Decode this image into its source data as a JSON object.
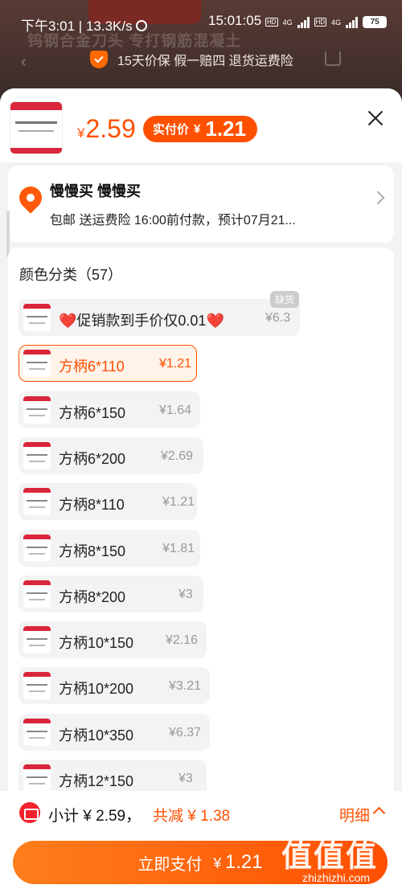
{
  "status_bar": {
    "left_text": "下午3:01 | 13.3K/s",
    "time": "15:01:05",
    "network_badge": "HD",
    "network_type": "4G",
    "battery": "75"
  },
  "background_page": {
    "banner_text": "钨钢合金刀头 专打钢筋混凝土",
    "guarantee_text": "15天价保  假一赔四  退货运费险"
  },
  "product": {
    "currency": "¥",
    "original_price": "2.59",
    "real_price_label": "实付价",
    "real_price": "1.21"
  },
  "address": {
    "name": "慢慢买 慢慢买",
    "info": "包邮  送运费险  16:00前付款，预计07月21..."
  },
  "variants": {
    "title": "颜色分类（57）",
    "out_of_stock_label": "缺货",
    "options": [
      {
        "name": "❤️促销款到手价仅0.01❤️",
        "price": "¥6.3"
      },
      {
        "name": "方柄6*110",
        "price": "¥1.21"
      },
      {
        "name": "方柄6*150",
        "price": "¥1.64"
      },
      {
        "name": "方柄6*200",
        "price": "¥2.69"
      },
      {
        "name": "方柄8*110",
        "price": "¥1.21"
      },
      {
        "name": "方柄8*150",
        "price": "¥1.81"
      },
      {
        "name": "方柄8*200",
        "price": "¥3"
      },
      {
        "name": "方柄10*150",
        "price": "¥2.16"
      },
      {
        "name": "方柄10*200",
        "price": "¥3.21"
      },
      {
        "name": "方柄10*350",
        "price": "¥6.37"
      },
      {
        "name": "方柄12*150",
        "price": "¥3"
      }
    ]
  },
  "bottom": {
    "subtotal": "小计 ¥ 2.59，",
    "discount": "共减 ¥ 1.38",
    "detail_label": "明细",
    "pay_label": "立即支付",
    "pay_currency": "¥",
    "pay_amount": "1.21"
  },
  "watermark": {
    "brand": "值值值",
    "url": "zhizhizhi.com"
  },
  "colors": {
    "accent": "#ff5000",
    "selected_bg": "#fff3ea",
    "price_gray": "#999999"
  }
}
